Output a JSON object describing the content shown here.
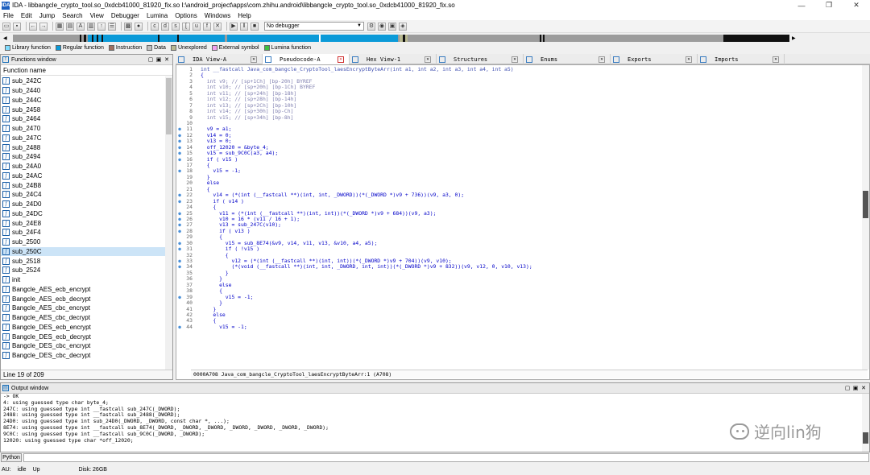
{
  "window": {
    "title": "IDA - libbangcle_crypto_tool.so_0xdcb41000_81920_fix.so I:\\android_project\\apps\\com.zhihu.android\\libbangcle_crypto_tool.so_0xdcb41000_81920_fix.so",
    "app_icon": "IDA"
  },
  "menu": [
    "File",
    "Edit",
    "Jump",
    "Search",
    "View",
    "Debugger",
    "Lumina",
    "Options",
    "Windows",
    "Help"
  ],
  "toolbar": {
    "debugger_select": "No debugger"
  },
  "legend": [
    {
      "label": "Library function",
      "color": "#7fdcff"
    },
    {
      "label": "Regular function",
      "color": "#0b9ad8"
    },
    {
      "label": "Instruction",
      "color": "#a07060"
    },
    {
      "label": "Data",
      "color": "#c0c0c0"
    },
    {
      "label": "Unexplored",
      "color": "#b8b890"
    },
    {
      "label": "External symbol",
      "color": "#f4a0f0"
    },
    {
      "label": "Lumina function",
      "color": "#40c040"
    }
  ],
  "functions_window": {
    "title": "Functions window",
    "column": "Function name",
    "items": [
      "sub_242C",
      "sub_2440",
      "sub_244C",
      "sub_2458",
      "sub_2464",
      "sub_2470",
      "sub_247C",
      "sub_2488",
      "sub_2494",
      "sub_24A0",
      "sub_24AC",
      "sub_24B8",
      "sub_24C4",
      "sub_24D0",
      "sub_24DC",
      "sub_24E8",
      "sub_24F4",
      "sub_2500",
      "sub_250C",
      "sub_2518",
      "sub_2524",
      "init",
      "Bangcle_AES_ecb_encrypt",
      "Bangcle_AES_ecb_decrypt",
      "Bangcle_AES_cbc_encrypt",
      "Bangcle_AES_cbc_decrypt",
      "Bangcle_DES_ecb_encrypt",
      "Bangcle_DES_ecb_decrypt",
      "Bangcle_DES_cbc_encrypt",
      "Bangcle_DES_cbc_decrypt"
    ],
    "selected_index": 18,
    "status": "Line 19 of 209"
  },
  "tabs": [
    {
      "label": "IDA View-A",
      "active": false
    },
    {
      "label": "Pseudocode-A",
      "active": true
    },
    {
      "label": "Hex View-1",
      "active": false
    },
    {
      "label": "Structures",
      "active": false
    },
    {
      "label": "Enums",
      "active": false
    },
    {
      "label": "Exports",
      "active": false
    },
    {
      "label": "Imports",
      "active": false
    }
  ],
  "pseudocode": {
    "lines": [
      {
        "n": "1",
        "dot": false,
        "cls": "hdr",
        "text": "int __fastcall Java_com_bangcle_CryptoTool_laesEncryptByteArr(int a1, int a2, int a3, int a4, int a5)"
      },
      {
        "n": "2",
        "dot": false,
        "cls": "",
        "text": "{"
      },
      {
        "n": "3",
        "dot": false,
        "cls": "cm",
        "text": "  int v9; // [sp+1Ch] [bp-20h] BYREF"
      },
      {
        "n": "4",
        "dot": false,
        "cls": "cm",
        "text": "  int v10; // [sp+20h] [bp-1Ch] BYREF"
      },
      {
        "n": "5",
        "dot": false,
        "cls": "cm",
        "text": "  int v11; // [sp+24h] [bp-18h]"
      },
      {
        "n": "6",
        "dot": false,
        "cls": "cm",
        "text": "  int v12; // [sp+28h] [bp-14h]"
      },
      {
        "n": "7",
        "dot": false,
        "cls": "cm",
        "text": "  int v13; // [sp+2Ch] [bp-10h]"
      },
      {
        "n": "8",
        "dot": false,
        "cls": "cm",
        "text": "  int v14; // [sp+30h] [bp-Ch]"
      },
      {
        "n": "9",
        "dot": false,
        "cls": "cm",
        "text": "  int v15; // [sp+34h] [bp-8h]"
      },
      {
        "n": "10",
        "dot": false,
        "cls": "",
        "text": ""
      },
      {
        "n": "11",
        "dot": true,
        "cls": "",
        "text": "  v9 = a1;"
      },
      {
        "n": "12",
        "dot": true,
        "cls": "",
        "text": "  v14 = 0;"
      },
      {
        "n": "13",
        "dot": true,
        "cls": "",
        "text": "  v13 = 0;"
      },
      {
        "n": "14",
        "dot": true,
        "cls": "",
        "text": "  off_12020 = &byte_4;"
      },
      {
        "n": "15",
        "dot": true,
        "cls": "",
        "text": "  v15 = sub_9C0C(a3, a4);"
      },
      {
        "n": "16",
        "dot": true,
        "cls": "",
        "text": "  if ( v15 )"
      },
      {
        "n": "17",
        "dot": false,
        "cls": "",
        "text": "  {"
      },
      {
        "n": "18",
        "dot": true,
        "cls": "",
        "text": "    v15 = -1;"
      },
      {
        "n": "19",
        "dot": false,
        "cls": "",
        "text": "  }"
      },
      {
        "n": "20",
        "dot": false,
        "cls": "",
        "text": "  else"
      },
      {
        "n": "21",
        "dot": false,
        "cls": "",
        "text": "  {"
      },
      {
        "n": "22",
        "dot": true,
        "cls": "",
        "text": "    v14 = (*(int (__fastcall **)(int, int, _DWORD))(*(_DWORD *)v9 + 736))(v9, a3, 0);"
      },
      {
        "n": "23",
        "dot": true,
        "cls": "",
        "text": "    if ( v14 )"
      },
      {
        "n": "24",
        "dot": false,
        "cls": "",
        "text": "    {"
      },
      {
        "n": "25",
        "dot": true,
        "cls": "",
        "text": "      v11 = (*(int (__fastcall **)(int, int))(*(_DWORD *)v9 + 684))(v9, a3);"
      },
      {
        "n": "26",
        "dot": true,
        "cls": "",
        "text": "      v10 = 16 * (v11 / 16 + 1);"
      },
      {
        "n": "27",
        "dot": true,
        "cls": "",
        "text": "      v13 = sub_247C(v10);"
      },
      {
        "n": "28",
        "dot": true,
        "cls": "",
        "text": "      if ( v13 )"
      },
      {
        "n": "29",
        "dot": false,
        "cls": "",
        "text": "      {"
      },
      {
        "n": "30",
        "dot": true,
        "cls": "",
        "text": "        v15 = sub_8E74(&v9, v14, v11, v13, &v10, a4, a5);"
      },
      {
        "n": "31",
        "dot": true,
        "cls": "",
        "text": "        if ( !v15 )"
      },
      {
        "n": "32",
        "dot": false,
        "cls": "",
        "text": "        {"
      },
      {
        "n": "33",
        "dot": true,
        "cls": "",
        "text": "          v12 = (*(int (__fastcall **)(int, int))(*(_DWORD *)v9 + 704))(v9, v10);"
      },
      {
        "n": "34",
        "dot": true,
        "cls": "",
        "text": "          (*(void (__fastcall **)(int, int, _DWORD, int, int))(*(_DWORD *)v9 + 832))(v9, v12, 0, v10, v13);"
      },
      {
        "n": "35",
        "dot": false,
        "cls": "",
        "text": "        }"
      },
      {
        "n": "36",
        "dot": false,
        "cls": "",
        "text": "      }"
      },
      {
        "n": "37",
        "dot": false,
        "cls": "",
        "text": "      else"
      },
      {
        "n": "38",
        "dot": false,
        "cls": "",
        "text": "      {"
      },
      {
        "n": "39",
        "dot": true,
        "cls": "",
        "text": "        v15 = -1;"
      },
      {
        "n": "40",
        "dot": false,
        "cls": "",
        "text": "      }"
      },
      {
        "n": "41",
        "dot": false,
        "cls": "",
        "text": "    }"
      },
      {
        "n": "42",
        "dot": false,
        "cls": "",
        "text": "    else"
      },
      {
        "n": "43",
        "dot": false,
        "cls": "",
        "text": "    {"
      },
      {
        "n": "44",
        "dot": true,
        "cls": "",
        "text": "      v15 = -1;"
      }
    ],
    "status": "0000A708 Java_com_bangcle_CryptoTool_laesEncryptByteArr:1 (A708)"
  },
  "output_window": {
    "title": "Output window",
    "lines": [
      "-> OK",
      "4: using guessed type char byte_4;",
      "247C: using guessed type int __fastcall sub_247C(_DWORD);",
      "2488: using guessed type int __fastcall sub_2488(_DWORD);",
      "24D0: using guessed type int sub_24D0(_DWORD, _DWORD, const char *, ...);",
      "8E74: using guessed type int __fastcall sub_8E74(_DWORD, _DWORD, _DWORD, _DWORD, _DWORD, _DWORD, _DWORD);",
      "9C0C: using guessed type int __fastcall sub_9C0C(_DWORD, _DWORD);",
      "12020: using guessed type char *off_12020;"
    ]
  },
  "watermark": "逆向lin狗",
  "cmd": {
    "button": "Python"
  },
  "status": {
    "au": "AU:",
    "state": "idle",
    "dir": "Up",
    "disk": "Disk: 26GB"
  }
}
